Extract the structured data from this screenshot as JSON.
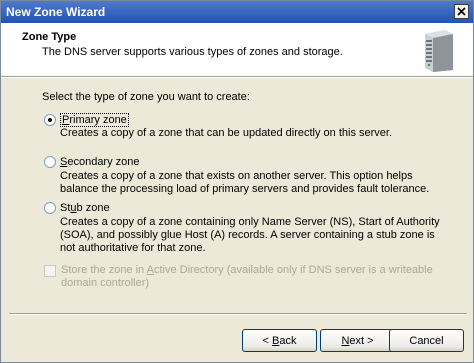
{
  "window": {
    "title": "New Zone Wizard"
  },
  "header": {
    "title": "Zone Type",
    "subtitle": "The DNS server supports various types of zones and storage."
  },
  "prompt": "Select the type of zone you want to create:",
  "options": [
    {
      "label_before": "",
      "label_mnemonic": "P",
      "label_after": "rimary zone",
      "selected": true,
      "description": "Creates a copy of a zone that can be updated directly on this server."
    },
    {
      "label_before": "",
      "label_mnemonic": "S",
      "label_after": "econdary zone",
      "selected": false,
      "description": "Creates a copy of a zone that exists on another server. This option helps balance the processing load of primary servers and provides fault tolerance."
    },
    {
      "label_before": "St",
      "label_mnemonic": "u",
      "label_after": "b zone",
      "selected": false,
      "description": "Creates a copy of a zone containing only Name Server (NS), Start of Authority (SOA), and possibly glue Host (A) records. A server containing a stub zone is not authoritative for that zone."
    }
  ],
  "ad_checkbox": {
    "label_before": "Store the zone in ",
    "label_mnemonic": "A",
    "label_after": "ctive Directory (available only if DNS server is a writeable domain controller)",
    "checked": false,
    "enabled": false
  },
  "buttons": {
    "back": {
      "prefix": "< ",
      "mnemonic": "B",
      "rest": "ack"
    },
    "next": {
      "mnemonic": "N",
      "rest": "ext >"
    },
    "cancel": "Cancel"
  },
  "icons": {
    "close": "close-icon",
    "header": "server-icon",
    "selected_radio": "radio-dot-icon"
  },
  "colors": {
    "title_bar": "#2453b8",
    "dialog_bg": "#ece9d8",
    "disabled_text": "#aca899"
  }
}
